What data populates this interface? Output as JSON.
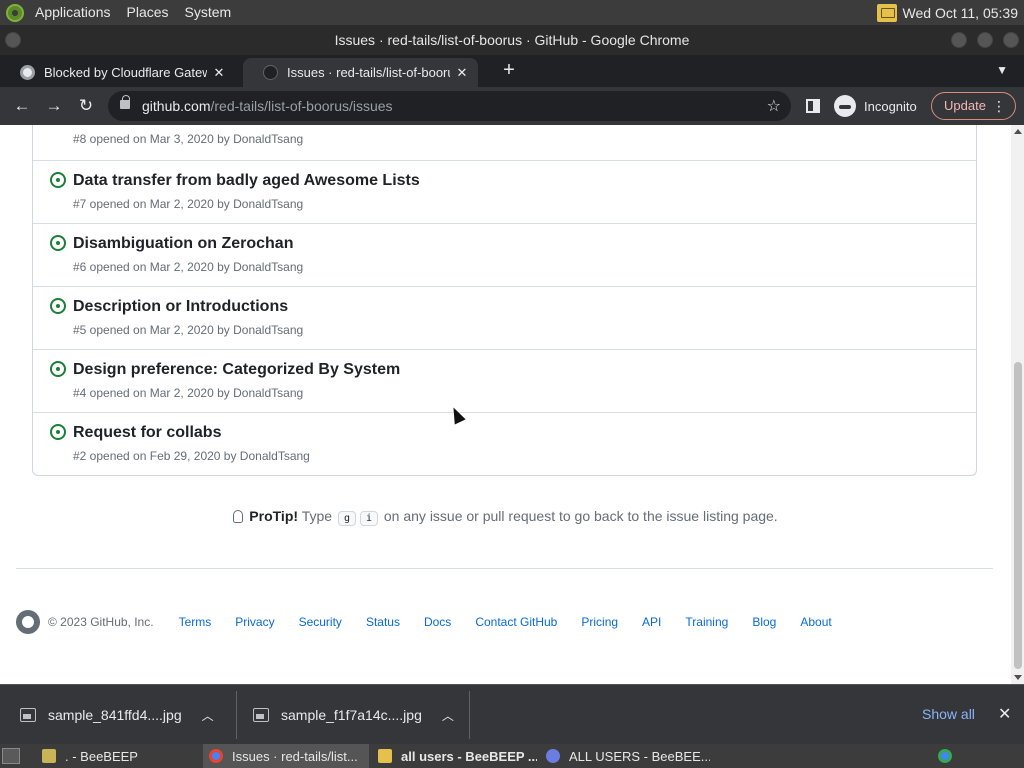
{
  "top_panel": {
    "menu": [
      "Applications",
      "Places",
      "System"
    ],
    "clock": "Wed Oct 11, 05:39"
  },
  "window": {
    "title": "Issues · red-tails/list-of-boorus · GitHub - Google Chrome"
  },
  "tabs": [
    {
      "label": "Blocked by Cloudflare Gatewa",
      "active": false
    },
    {
      "label": "Issues · red-tails/list-of-booru",
      "active": true
    }
  ],
  "toolbar": {
    "url_host": "github.com",
    "url_path": "/red-tails/list-of-boorus/issues",
    "incognito_label": "Incognito",
    "update_label": "Update"
  },
  "issues": [
    {
      "title": "",
      "meta": "#8 opened on Mar 3, 2020 by DonaldTsang"
    },
    {
      "title": "Data transfer from badly aged Awesome Lists",
      "meta": "#7 opened on Mar 2, 2020 by DonaldTsang"
    },
    {
      "title": "Disambiguation on Zerochan",
      "meta": "#6 opened on Mar 2, 2020 by DonaldTsang"
    },
    {
      "title": "Description or Introductions",
      "meta": "#5 opened on Mar 2, 2020 by DonaldTsang"
    },
    {
      "title": "Design preference: Categorized By System",
      "meta": "#4 opened on Mar 2, 2020 by DonaldTsang"
    },
    {
      "title": "Request for collabs",
      "meta": "#2 opened on Feb 29, 2020 by DonaldTsang"
    }
  ],
  "protip": {
    "label": "ProTip!",
    "before": "Type",
    "key1": "g",
    "key2": "i",
    "after": "on any issue or pull request to go back to the issue listing page."
  },
  "footer": {
    "copyright": "© 2023 GitHub, Inc.",
    "links": [
      "Terms",
      "Privacy",
      "Security",
      "Status",
      "Docs",
      "Contact GitHub",
      "Pricing",
      "API",
      "Training",
      "Blog",
      "About"
    ]
  },
  "downloads": {
    "items": [
      "sample_841ffd4....jpg",
      "sample_f1f7a14c....jpg"
    ],
    "show_all": "Show all"
  },
  "taskbar": {
    "items": [
      ". - BeeBEEP",
      "Issues · red-tails/list...",
      "all users - BeeBEEP ...",
      "ALL USERS - BeeBEE..."
    ]
  },
  "colors": {
    "open_issue_green": "#1a7f37",
    "link_blue": "#0969da",
    "chrome_dark": "#35363a"
  }
}
